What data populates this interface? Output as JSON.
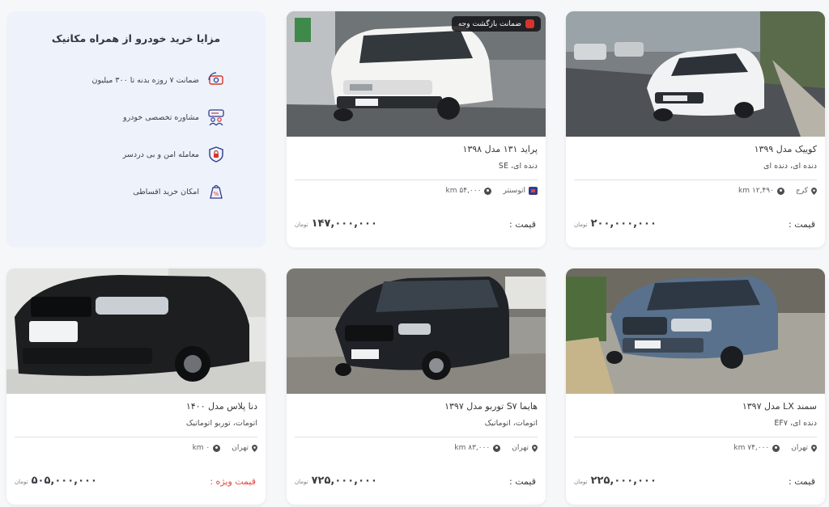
{
  "benefits": {
    "title": "مزایا خرید خودرو از همراه مکانیک",
    "items": [
      {
        "label": "ضمانت ۷ روزه بدنه تا ۳۰۰ میلیون",
        "icon": "money-guarantee-icon"
      },
      {
        "label": "مشاوره تخصصی خودرو",
        "icon": "consultation-icon"
      },
      {
        "label": "معامله امن و بی دردسر",
        "icon": "secure-shield-icon"
      },
      {
        "label": "امکان خرید اقساطی",
        "icon": "installment-bag-icon"
      }
    ]
  },
  "cards": [
    {
      "title": "کوییک مدل ۱۳۹۹",
      "subtitle": "دنده ای، دنده ای",
      "location": "کرج",
      "mileage": "۱۲,۴۹۰ km",
      "price_label": "قیمت :",
      "price": "۲۰۰,۰۰۰,۰۰۰",
      "unit": "تومان"
    },
    {
      "title": "پراید ۱۳۱ مدل ۱۳۹۸",
      "subtitle": "دنده ای، SE",
      "location": "اتوسنتر",
      "mileage": "۵۴,۰۰۰ km",
      "price_label": "قیمت :",
      "price": "۱۴۷,۰۰۰,۰۰۰",
      "unit": "تومان",
      "badge": "ضمانت بازگشت وجه"
    },
    {
      "title": "سمند LX مدل ۱۳۹۷",
      "subtitle": "دنده ای، EF۷",
      "location": "تهران",
      "mileage": "۷۴,۰۰۰ km",
      "price_label": "قیمت :",
      "price": "۲۲۵,۰۰۰,۰۰۰",
      "unit": "تومان"
    },
    {
      "title": "هایما S۷ توربو مدل ۱۳۹۷",
      "subtitle": "اتومات، اتوماتیک",
      "location": "تهران",
      "mileage": "۸۳,۰۰۰ km",
      "price_label": "قیمت :",
      "price": "۷۲۵,۰۰۰,۰۰۰",
      "unit": "تومان"
    },
    {
      "title": "دنا پلاس مدل ۱۴۰۰",
      "subtitle": "اتومات، توربو اتوماتیک",
      "location": "تهران",
      "mileage": "۰ km",
      "price_label": "قیمت ویژه :",
      "price": "۵۰۵,۰۰۰,۰۰۰",
      "unit": "تومان"
    }
  ],
  "colors": {
    "special_price": "#e0463c",
    "benefits_bg": "#eef2fb",
    "accent": "#2f3a8f"
  }
}
